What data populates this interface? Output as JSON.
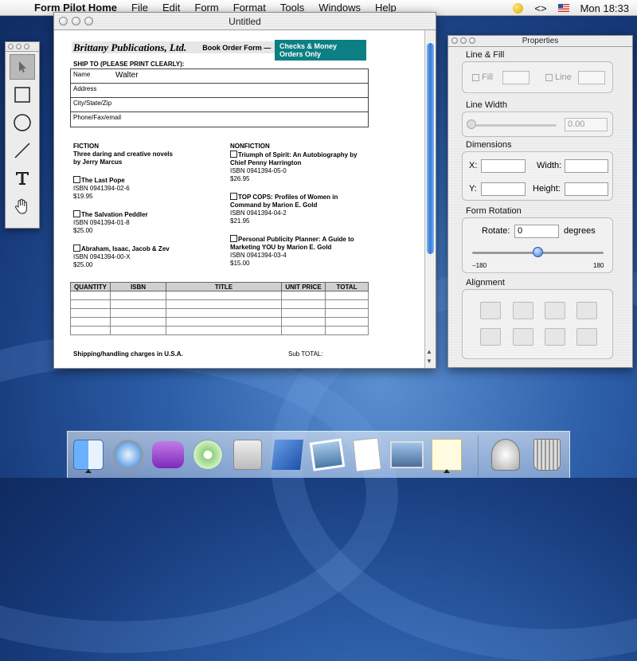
{
  "menubar": {
    "app": "Form Pilot Home",
    "items": [
      "File",
      "Edit",
      "Form",
      "Format",
      "Tools",
      "Windows",
      "Help"
    ],
    "code_symbol": "<>",
    "clock": "Mon 18:33"
  },
  "document": {
    "title": "Untitled",
    "brand": "Brittany Publications, Ltd.",
    "form_label": "Book Order Form —",
    "badge": "Checks & Money Orders Only",
    "ship_to_label": "SHIP TO (PLEASE PRINT CLEARLY):",
    "ship_fields": [
      {
        "label": "Name",
        "value": "Walter"
      },
      {
        "label": "Address",
        "value": ""
      },
      {
        "label": "City/State/Zip",
        "value": ""
      },
      {
        "label": "Phone/Fax/email",
        "value": ""
      }
    ],
    "fiction": {
      "heading": "FICTION",
      "intro1": "Three daring and creative novels",
      "intro2": "by Jerry Marcus",
      "books": [
        {
          "title": "The Last Pope",
          "isbn": "ISBN 0941394-02-6",
          "price": "$19.95"
        },
        {
          "title": "The Salvation Peddler",
          "isbn": "ISBN 0941394-01-8",
          "price": "$25.00"
        },
        {
          "title": "Abraham, Isaac, Jacob & Zev",
          "isbn": "ISBN 0941394-00-X",
          "price": "$25.00"
        }
      ]
    },
    "nonfiction": {
      "heading": "NONFICTION",
      "books": [
        {
          "title1": "Triumph of Spirit: An Autobiography by",
          "title2": "Chief Penny Harrington",
          "isbn": "ISBN 0941394-05-0",
          "price": "$26.95"
        },
        {
          "title1": "TOP COPS: Profiles of Women in",
          "title2": "Command by Marion E. Gold",
          "isbn": "ISBN 0941394-04-2",
          "price": "$21.95"
        },
        {
          "title1": "Personal Publicity Planner: A Guide to",
          "title2": "Marketing YOU by Marion E. Gold",
          "isbn": "ISBN 0941394-03-4",
          "price": "$15.00"
        }
      ]
    },
    "order_table": {
      "headers": [
        "QUANTITY",
        "ISBN",
        "TITLE",
        "UNIT PRICE",
        "TOTAL"
      ],
      "rows": 5
    },
    "shipping_label": "Shipping/handling charges in U.S.A.",
    "subtotal_label": "Sub TOTAL:"
  },
  "properties": {
    "title": "Properties",
    "line_fill": {
      "label": "Line & Fill",
      "fill": "Fill",
      "line": "Line"
    },
    "line_width": {
      "label": "Line Width",
      "value": "0.00"
    },
    "dimensions": {
      "label": "Dimensions",
      "x": "X:",
      "y": "Y:",
      "width": "Width:",
      "height": "Height:"
    },
    "rotation": {
      "label": "Form Rotation",
      "rotate": "Rotate:",
      "value": "0",
      "unit": "degrees",
      "min": "−180",
      "max": "180"
    },
    "alignment": {
      "label": "Alignment"
    }
  },
  "dock": [
    "Finder",
    "Safari",
    "Mail",
    "iTunes",
    "System Preferences",
    "Xcode",
    "iPhoto",
    "TextEdit",
    "Preview",
    "Form Pilot",
    "Mail Server",
    "Trash"
  ]
}
